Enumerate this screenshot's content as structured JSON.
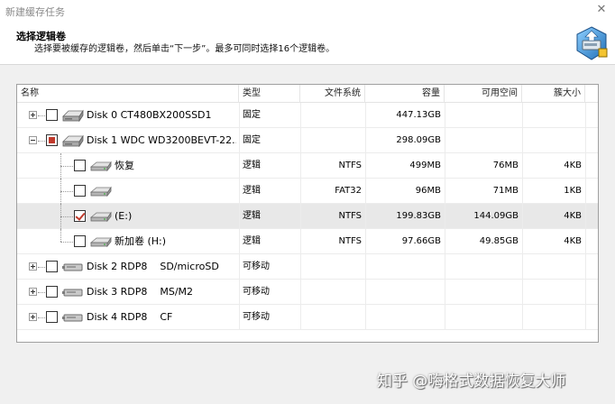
{
  "window": {
    "title": "新建缓存任务"
  },
  "header": {
    "title": "选择逻辑卷",
    "description": "选择要被缓存的逻辑卷，然后单击“下一步”。最多可同时选择16个逻辑卷。"
  },
  "columns": [
    {
      "key": "name",
      "label": "名称"
    },
    {
      "key": "type",
      "label": "类型"
    },
    {
      "key": "fs",
      "label": "文件系统"
    },
    {
      "key": "capacity",
      "label": "容量"
    },
    {
      "key": "free",
      "label": "可用空间"
    },
    {
      "key": "cluster",
      "label": "簇大小"
    }
  ],
  "rows": [
    {
      "name": "Disk 0 CT480BX200SSD1",
      "type": "固定",
      "fs": "",
      "capacity": "447.13GB",
      "free": "",
      "cluster": "",
      "check": "unchecked",
      "icon": "hard-disk-icon"
    },
    {
      "name": "Disk 1 WDC WD3200BEVT-22...",
      "type": "固定",
      "fs": "",
      "capacity": "298.09GB",
      "free": "",
      "cluster": "",
      "check": "partial",
      "icon": "hard-disk-icon"
    },
    {
      "name": "恢复",
      "type": "逻辑",
      "fs": "NTFS",
      "capacity": "499MB",
      "free": "76MB",
      "cluster": "4KB",
      "check": "unchecked",
      "icon": "volume-icon"
    },
    {
      "name": "",
      "type": "逻辑",
      "fs": "FAT32",
      "capacity": "96MB",
      "free": "71MB",
      "cluster": "1KB",
      "check": "unchecked",
      "icon": "volume-icon"
    },
    {
      "name": "(E:)",
      "type": "逻辑",
      "fs": "NTFS",
      "capacity": "199.83GB",
      "free": "144.09GB",
      "cluster": "4KB",
      "check": "checked",
      "icon": "volume-icon"
    },
    {
      "name": "新加卷 (H:)",
      "type": "逻辑",
      "fs": "NTFS",
      "capacity": "97.66GB",
      "free": "49.85GB",
      "cluster": "4KB",
      "check": "unchecked",
      "icon": "volume-icon"
    },
    {
      "name": "Disk 2 RDP8    SD/microSD",
      "type": "可移动",
      "fs": "",
      "capacity": "",
      "free": "",
      "cluster": "",
      "check": "unchecked",
      "icon": "removable-disk-icon"
    },
    {
      "name": "Disk 3 RDP8    MS/M2",
      "type": "可移动",
      "fs": "",
      "capacity": "",
      "free": "",
      "cluster": "",
      "check": "unchecked",
      "icon": "removable-disk-icon"
    },
    {
      "name": "Disk 4 RDP8    CF",
      "type": "可移动",
      "fs": "",
      "capacity": "",
      "free": "",
      "cluster": "",
      "check": "unchecked",
      "icon": "removable-disk-icon"
    }
  ],
  "watermark": "知乎 @嗨格式数据恢复大师"
}
